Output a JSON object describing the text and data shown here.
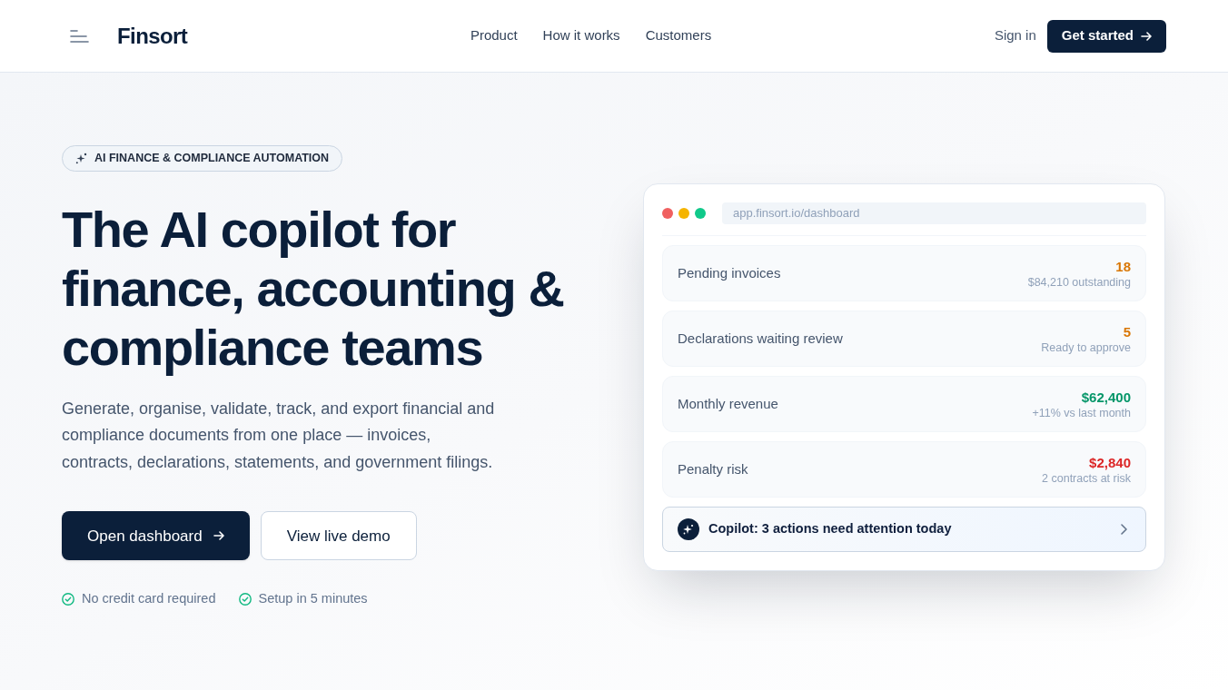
{
  "header": {
    "logo": "Finsort",
    "nav": [
      "Product",
      "How it works",
      "Customers"
    ],
    "sign_in": "Sign in",
    "cta": "Get started"
  },
  "hero": {
    "badge": "AI FINANCE & COMPLIANCE AUTOMATION",
    "title": "The AI copilot for finance, accounting & compliance teams",
    "description": "Generate, organise, validate, track, and export financial and compliance documents from one place — invoices, contracts, declarations, statements, and government filings.",
    "buttons": [
      {
        "label": "Open dashboard",
        "kind": "primary"
      },
      {
        "label": "View live demo",
        "kind": "secondary"
      }
    ],
    "perks": [
      "No credit card required",
      "Setup in 5 minutes"
    ]
  },
  "dashboard": {
    "url": "app.finsort.io/dashboard",
    "metrics": [
      {
        "label": "Pending invoices",
        "value": "18",
        "note": "$84,210 outstanding",
        "color": "#d97706"
      },
      {
        "label": "Declarations waiting review",
        "value": "5",
        "note": "Ready to approve",
        "color": "#d97706"
      },
      {
        "label": "Monthly revenue",
        "value": "$62,400",
        "note": "+11% vs last month",
        "color": "#059669"
      },
      {
        "label": "Penalty risk",
        "value": "$2,840",
        "note": "2 contracts at risk",
        "color": "#dc2626"
      }
    ],
    "copilot": "Copilot: 3 actions need attention today"
  }
}
